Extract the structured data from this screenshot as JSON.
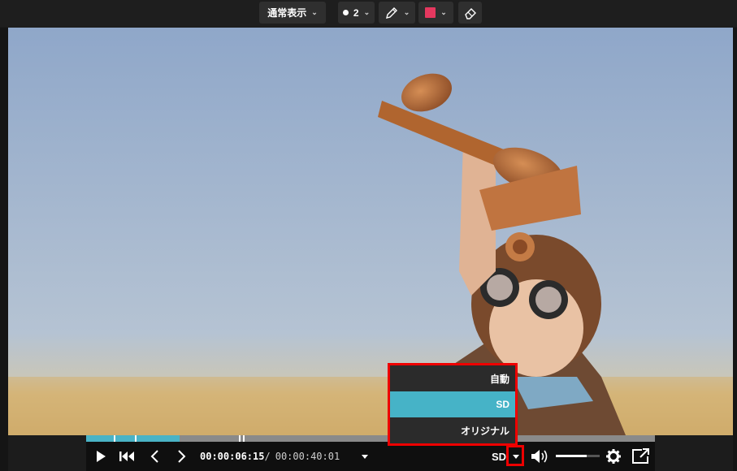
{
  "toolbar": {
    "view_mode_label": "通常表示",
    "stroke_size": "2",
    "pencil_icon": "pencil-icon",
    "color": "#e5385f",
    "eraser_icon": "eraser-icon"
  },
  "player": {
    "current_time": "00:00:06:15",
    "separator": "/",
    "total_time": "00:00:40:01",
    "quality_label": "SD",
    "progress_buffered": 0.164,
    "volume_level": 0.7,
    "icons": {
      "play": "play-icon",
      "skip_start": "skip-to-start-icon",
      "prev_frame": "chevron-left-icon",
      "next_frame": "chevron-right-icon",
      "volume": "volume-icon",
      "settings": "gear-icon",
      "popout": "external-window-icon"
    }
  },
  "quality_menu": {
    "items": [
      {
        "label": "自動",
        "selected": false
      },
      {
        "label": "SD",
        "selected": true
      },
      {
        "label": "オリジナル",
        "selected": false
      }
    ],
    "highlight_color": "#46b3c7"
  },
  "accent_color": "#4ab3c6",
  "highlight_outline_color": "#ee0000"
}
